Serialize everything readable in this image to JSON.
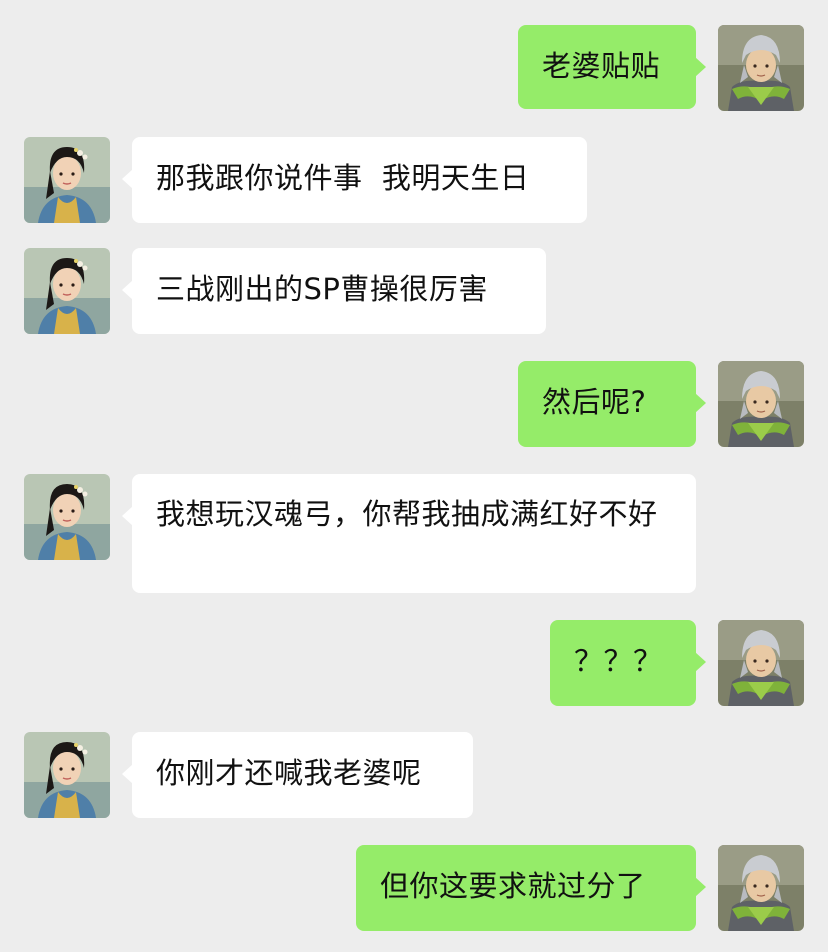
{
  "chat": {
    "messages": [
      {
        "side": "out",
        "text": "老婆贴贴",
        "avatar": "warrior-avatar"
      },
      {
        "side": "in",
        "text": "那我跟你说件事  我明天生日",
        "avatar": "lady-avatar"
      },
      {
        "side": "in",
        "text": "三战刚出的SP曹操很厉害",
        "avatar": "lady-avatar"
      },
      {
        "side": "out",
        "text": "然后呢?",
        "avatar": "warrior-avatar"
      },
      {
        "side": "in",
        "text": "我想玩汉魂弓，你帮我抽成满红好不好",
        "avatar": "lady-avatar"
      },
      {
        "side": "out",
        "text": "？？？",
        "avatar": "warrior-avatar"
      },
      {
        "side": "in",
        "text": "你刚才还喊我老婆呢",
        "avatar": "lady-avatar"
      },
      {
        "side": "out",
        "text": "但你这要求就过分了",
        "avatar": "warrior-avatar"
      }
    ]
  },
  "colors": {
    "background": "#ededed",
    "incoming_bubble": "#ffffff",
    "outgoing_bubble": "#95ec69"
  }
}
